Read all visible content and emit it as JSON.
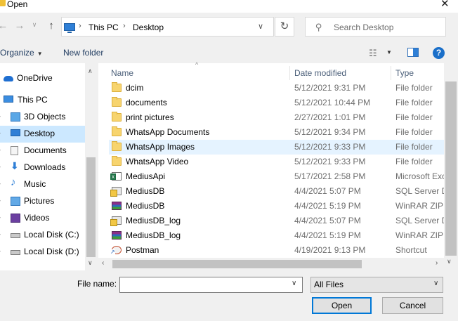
{
  "window": {
    "title": "Open"
  },
  "address": {
    "crumbs": [
      "This PC",
      "Desktop"
    ]
  },
  "search": {
    "placeholder": "Search Desktop"
  },
  "toolbar": {
    "organize_label": "Organize",
    "new_folder_label": "New folder"
  },
  "nav": {
    "items": [
      {
        "label": "OneDrive",
        "icon": "cloud-icon"
      },
      {
        "label": "This PC",
        "icon": "computer-icon"
      },
      {
        "label": "3D Objects",
        "icon": "cube-icon"
      },
      {
        "label": "Desktop",
        "icon": "desktop-icon",
        "selected": true
      },
      {
        "label": "Documents",
        "icon": "documents-icon"
      },
      {
        "label": "Downloads",
        "icon": "download-icon"
      },
      {
        "label": "Music",
        "icon": "music-icon"
      },
      {
        "label": "Pictures",
        "icon": "pictures-icon"
      },
      {
        "label": "Videos",
        "icon": "videos-icon"
      },
      {
        "label": "Local Disk (C:)",
        "icon": "disk-icon"
      },
      {
        "label": "Local Disk (D:)",
        "icon": "disk-icon"
      }
    ]
  },
  "columns": {
    "name": "Name",
    "date": "Date modified",
    "type": "Type"
  },
  "files": [
    {
      "name": "dcim",
      "date": "5/12/2021 9:31 PM",
      "type": "File folder",
      "icon": "folder-icon"
    },
    {
      "name": "documents",
      "date": "5/12/2021 10:44 PM",
      "type": "File folder",
      "icon": "folder-icon"
    },
    {
      "name": "print pictures",
      "date": "2/27/2021 1:01 PM",
      "type": "File folder",
      "icon": "folder-icon"
    },
    {
      "name": "WhatsApp Documents",
      "date": "5/12/2021 9:34 PM",
      "type": "File folder",
      "icon": "folder-icon"
    },
    {
      "name": "WhatsApp Images",
      "date": "5/12/2021 9:33 PM",
      "type": "File folder",
      "icon": "folder-icon",
      "hover": true
    },
    {
      "name": "WhatsApp Video",
      "date": "5/12/2021 9:33 PM",
      "type": "File folder",
      "icon": "folder-icon"
    },
    {
      "name": "MediusApi",
      "date": "5/17/2021 2:58 PM",
      "type": "Microsoft Exc",
      "icon": "excel-file-icon"
    },
    {
      "name": "MediusDB",
      "date": "4/4/2021 5:07 PM",
      "type": "SQL Server D",
      "icon": "sql-file-icon"
    },
    {
      "name": "MediusDB",
      "date": "4/4/2021 5:19 PM",
      "type": "WinRAR ZIP a",
      "icon": "winrar-archive-icon"
    },
    {
      "name": "MediusDB_log",
      "date": "4/4/2021 5:07 PM",
      "type": "SQL Server D",
      "icon": "sql-file-icon"
    },
    {
      "name": "MediusDB_log",
      "date": "4/4/2021 5:19 PM",
      "type": "WinRAR ZIP a",
      "icon": "winrar-archive-icon"
    },
    {
      "name": "Postman",
      "date": "4/19/2021 9:13 PM",
      "type": "Shortcut",
      "icon": "shortcut-icon"
    }
  ],
  "bottom": {
    "filename_label": "File name:",
    "filename_value": "",
    "filetype_value": "All Files",
    "open_label": "Open",
    "cancel_label": "Cancel"
  },
  "colors": {
    "selected_bg": "#cce8ff",
    "hover_bg": "#e5f3ff",
    "accent": "#0078d7",
    "folder": "#f7d46e"
  }
}
